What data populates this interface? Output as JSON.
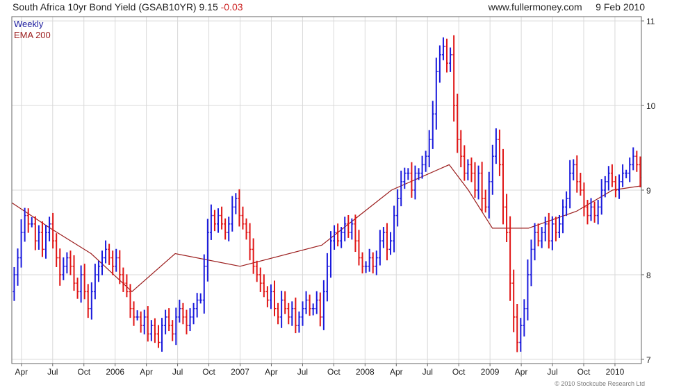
{
  "header": {
    "title": "South Africa 10yr Bond Yield (GSAB10YR)",
    "last": "9.15",
    "change": "-0.03",
    "site": "www.fullermoney.com",
    "date": "9 Feb 2010"
  },
  "legend": {
    "series1": "Weekly",
    "series2": "EMA 200"
  },
  "copyright": "© 2010 Stockcube Research Ltd",
  "colors": {
    "up": "#1a1adc",
    "down": "#e01515",
    "ema": "#9b1c1c",
    "grid": "#d9d9d9",
    "legend1": "#1a1a9c",
    "legend2": "#9b1c1c"
  },
  "chart_data": {
    "type": "ohlc",
    "title": "South Africa 10yr Bond Yield (GSAB10YR)",
    "xaxis": {
      "ticks": [
        "Apr",
        "Jul",
        "Oct",
        "2006",
        "Apr",
        "Jul",
        "Oct",
        "2007",
        "Apr",
        "Jul",
        "Oct",
        "2008",
        "Apr",
        "Jul",
        "Oct",
        "2009",
        "Apr",
        "Jul",
        "Oct",
        "2010"
      ],
      "tick_index": [
        4,
        17,
        30,
        43,
        56,
        69,
        82,
        95,
        108,
        121,
        134,
        147,
        160,
        173,
        186,
        199,
        212,
        225,
        238,
        251
      ],
      "range": [
        0,
        262
      ]
    },
    "yaxis": {
      "range": [
        6.95,
        11.05
      ],
      "ticks": [
        7,
        8,
        9,
        10,
        11
      ],
      "side": "right"
    },
    "grid": true,
    "legend_position": "top-left",
    "series": [
      {
        "name": "Weekly",
        "kind": "ohlc",
        "start_close": 7.8,
        "closes": [
          8.0,
          8.2,
          8.5,
          8.7,
          8.6,
          8.6,
          8.4,
          8.5,
          8.3,
          8.5,
          8.6,
          8.4,
          8.2,
          8.0,
          8.1,
          8.2,
          8.1,
          7.9,
          7.8,
          8.0,
          7.8,
          7.6,
          7.8,
          8.0,
          8.1,
          8.2,
          8.3,
          8.2,
          8.1,
          8.2,
          8.0,
          7.9,
          7.8,
          7.6,
          7.5,
          7.5,
          7.4,
          7.5,
          7.3,
          7.4,
          7.3,
          7.2,
          7.4,
          7.5,
          7.4,
          7.3,
          7.5,
          7.6,
          7.5,
          7.4,
          7.5,
          7.6,
          7.7,
          7.7,
          8.1,
          8.5,
          8.7,
          8.6,
          8.7,
          8.6,
          8.5,
          8.6,
          8.8,
          8.9,
          8.7,
          8.6,
          8.5,
          8.3,
          8.1,
          8.0,
          7.9,
          7.8,
          7.7,
          7.8,
          7.6,
          7.5,
          7.7,
          7.6,
          7.5,
          7.6,
          7.4,
          7.5,
          7.6,
          7.7,
          7.6,
          7.6,
          7.7,
          7.5,
          7.8,
          8.1,
          8.4,
          8.5,
          8.4,
          8.5,
          8.6,
          8.5,
          8.6,
          8.4,
          8.2,
          8.1,
          8.1,
          8.2,
          8.1,
          8.2,
          8.4,
          8.5,
          8.3,
          8.4,
          8.7,
          8.9,
          9.1,
          9.2,
          9.2,
          9.0,
          9.2,
          9.2,
          9.3,
          9.4,
          9.6,
          9.9,
          10.4,
          10.6,
          10.7,
          10.5,
          10.6,
          10.0,
          9.6,
          9.4,
          9.2,
          9.3,
          9.2,
          9.0,
          9.2,
          8.9,
          8.8,
          9.1,
          9.4,
          9.6,
          9.3,
          8.8,
          8.5,
          7.9,
          7.5,
          7.2,
          7.4,
          7.6,
          8.0,
          8.3,
          8.5,
          8.4,
          8.5,
          8.6,
          8.4,
          8.6,
          8.5,
          8.6,
          8.8,
          8.9,
          9.2,
          9.3,
          9.1,
          9.0,
          8.8,
          8.7,
          8.8,
          8.7,
          8.8,
          9.0,
          9.1,
          9.2,
          9.1,
          9.0,
          9.1,
          9.2,
          9.2,
          9.3,
          9.4,
          9.3,
          9.15
        ]
      },
      {
        "name": "EMA 200",
        "kind": "line",
        "x": [
          0,
          16,
          33,
          50,
          68,
          95,
          129,
          158,
          182,
          190,
          200,
          215,
          235,
          250,
          262
        ],
        "y": [
          8.85,
          8.55,
          8.25,
          7.8,
          8.25,
          8.1,
          8.35,
          9.0,
          9.3,
          9.0,
          8.55,
          8.55,
          8.75,
          9.0,
          9.05
        ]
      }
    ]
  }
}
